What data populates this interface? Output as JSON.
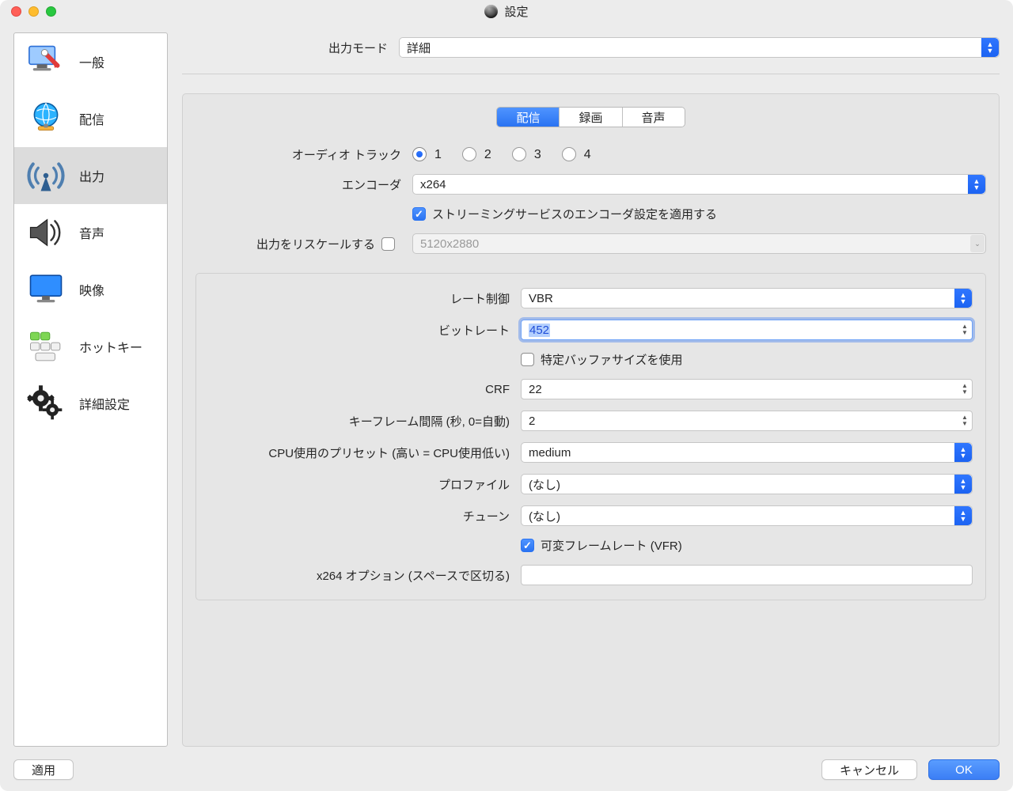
{
  "window": {
    "title": "設定"
  },
  "sidebar": {
    "items": [
      {
        "label": "一般"
      },
      {
        "label": "配信"
      },
      {
        "label": "出力"
      },
      {
        "label": "音声"
      },
      {
        "label": "映像"
      },
      {
        "label": "ホットキー"
      },
      {
        "label": "詳細設定"
      }
    ],
    "active_index": 2
  },
  "output_mode": {
    "label": "出力モード",
    "value": "詳細"
  },
  "tabs": {
    "options": [
      "配信",
      "録画",
      "音声"
    ],
    "active": "配信"
  },
  "stream": {
    "audio_track_label": "オーディオ トラック",
    "audio_track_options": [
      "1",
      "2",
      "3",
      "4"
    ],
    "audio_track_value": "1",
    "encoder_label": "エンコーダ",
    "encoder_value": "x264",
    "apply_service_settings_label": "ストリーミングサービスのエンコーダ設定を適用する",
    "apply_service_settings_checked": true,
    "rescale_label": "出力をリスケールする",
    "rescale_checked": false,
    "rescale_value": "5120x2880"
  },
  "encoder_settings": {
    "rate_control_label": "レート制御",
    "rate_control_value": "VBR",
    "bitrate_label": "ビットレート",
    "bitrate_value": "452",
    "use_custom_buffer_label": "特定バッファサイズを使用",
    "use_custom_buffer_checked": false,
    "crf_label": "CRF",
    "crf_value": "22",
    "keyframe_label": "キーフレーム間隔 (秒, 0=自動)",
    "keyframe_value": "2",
    "cpu_preset_label": "CPU使用のプリセット (高い = CPU使用低い)",
    "cpu_preset_value": "medium",
    "profile_label": "プロファイル",
    "profile_value": "(なし)",
    "tune_label": "チューン",
    "tune_value": "(なし)",
    "vfr_label": "可変フレームレート (VFR)",
    "vfr_checked": true,
    "x264opts_label": "x264 オプション (スペースで区切る)",
    "x264opts_value": ""
  },
  "buttons": {
    "apply": "適用",
    "cancel": "キャンセル",
    "ok": "OK"
  }
}
